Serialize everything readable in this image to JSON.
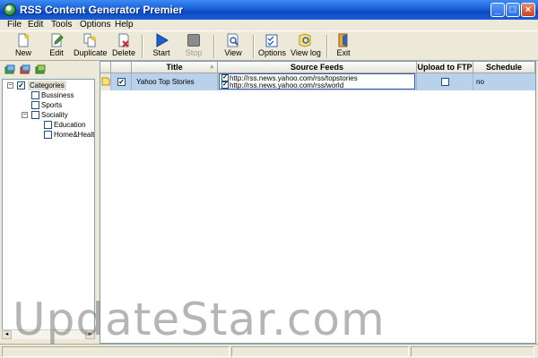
{
  "window": {
    "title": "RSS Content Generator Premier"
  },
  "menu": [
    "File",
    "Edit",
    "Tools",
    "Options",
    "Help"
  ],
  "toolbar": {
    "new": "New",
    "edit": "Edit",
    "duplicate": "Duplicate",
    "delete": "Delete",
    "start": "Start",
    "stop": "Stop",
    "view": "View",
    "options": "Options",
    "view_log": "View log",
    "exit": "Exit"
  },
  "tree": {
    "root": "Categories",
    "items": [
      "Bussiness",
      "Sports",
      "Sociality",
      "Education",
      "Home&Health"
    ]
  },
  "grid": {
    "columns": [
      "Title",
      "Source Feeds",
      "Upload to FTP",
      "Schedule"
    ],
    "rows": [
      {
        "title": "Yahoo Top Stories",
        "feeds": [
          "http://rss.news.yahoo.com/rss/topstories",
          "http://rss.news.yahoo.com/rss/world"
        ],
        "schedule": "no"
      }
    ]
  },
  "watermark": "UpdateStar.com",
  "colors": {
    "title_bar": "#0a49c4",
    "selected_row": "#b9d1ea",
    "start_icon": "#1f5fd0"
  },
  "icons": [
    "app-icon",
    "new-icon",
    "edit-icon",
    "duplicate-icon",
    "delete-icon",
    "start-icon",
    "stop-icon",
    "view-icon",
    "options-icon",
    "view-log-icon",
    "exit-icon"
  ]
}
